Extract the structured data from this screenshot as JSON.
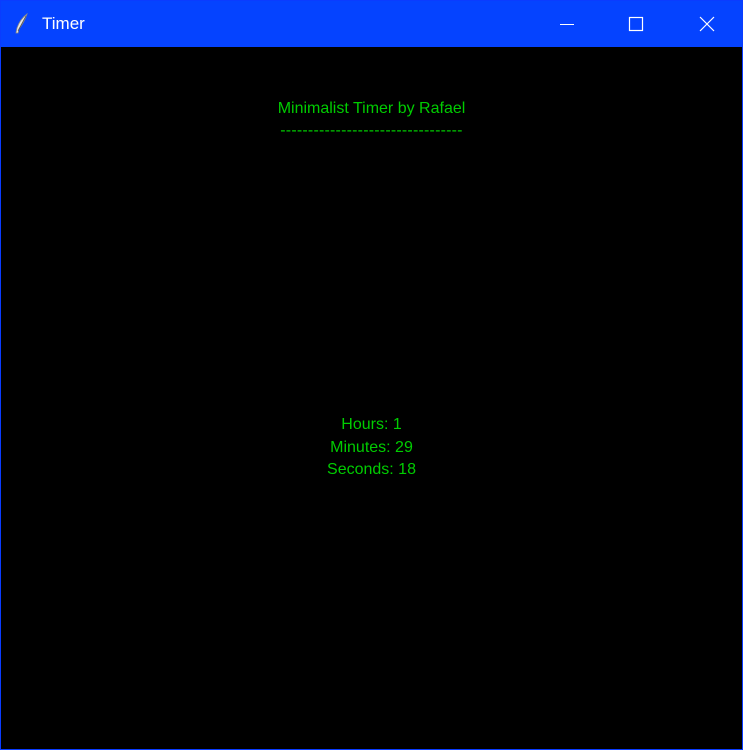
{
  "window": {
    "title": "Timer",
    "app_icon": "feather-icon",
    "controls": {
      "minimize_icon": "minimize-icon",
      "maximize_icon": "maximize-icon",
      "close_icon": "close-icon"
    },
    "colors": {
      "titlebar": "#0543ff",
      "background": "#000000",
      "text": "#00cc00"
    }
  },
  "content": {
    "heading": "Minimalist Timer by Rafael",
    "divider": "---------------------------------",
    "hours_label": "Hours: 1",
    "minutes_label": "Minutes: 29",
    "seconds_label": "Seconds: 18"
  }
}
